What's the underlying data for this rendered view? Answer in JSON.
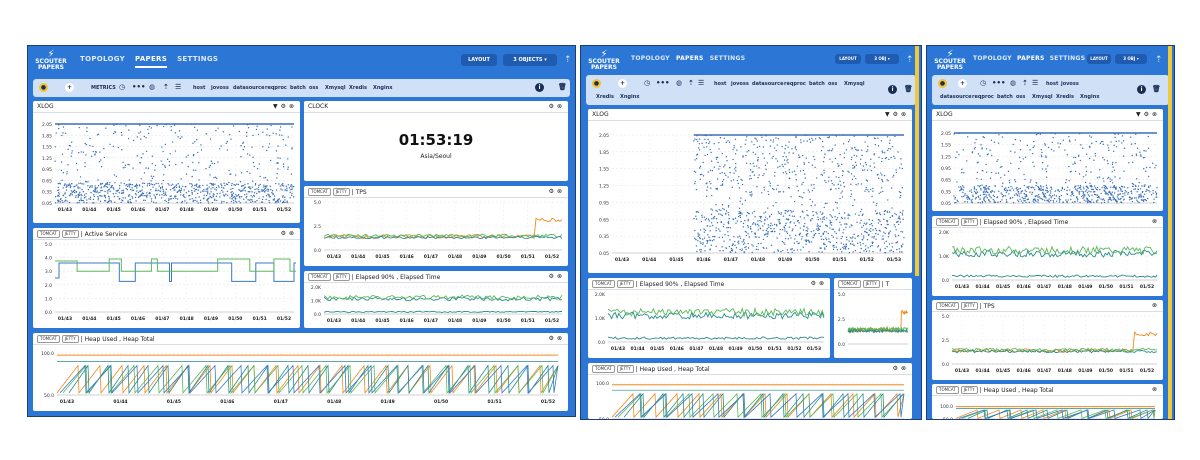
{
  "app": {
    "logo_line1": "SCOUTER",
    "logo_line2": "PAPERS",
    "nav": [
      "TOPOLOGY",
      "PAPERS",
      "SETTINGS"
    ],
    "layout_label": "LAYOUT",
    "objects_label_full": "3 OBJECTS",
    "objects_label_short": "3 OBJ"
  },
  "toolbar": {
    "metrics_label": "METRICS",
    "filters": [
      "host",
      "jovoss",
      "datasource",
      "reqproc",
      "batch",
      "oss",
      "Xmysql",
      "Xredis",
      "Xnginx"
    ]
  },
  "panels": {
    "xlog_title": "XLOG",
    "clock_title": "CLOCK",
    "clock_time": "01:53:19",
    "clock_timezone": "Asia/Seoul",
    "tag_a": "TOMCAT",
    "tag_b": "JETTY",
    "tps_title": "| TPS",
    "active_title": "| Active Service",
    "elapsed_title": "| Elapsed 90% , Elapsed Time",
    "heap_title": "| Heap Used , Heap Total",
    "tps_title_short": "| T"
  },
  "axes": {
    "xlog_y": [
      "2.05",
      "1.85",
      "1.55",
      "1.25",
      "0.95",
      "0.65",
      "0.35",
      "0.05"
    ],
    "xlog_y_sparse": [
      "2.05",
      "1.55",
      "1.25",
      "0.95",
      "0.65",
      "0.35",
      "0.05"
    ],
    "time_ticks": [
      "01/43",
      "01/44",
      "01/45",
      "01/46",
      "01/47",
      "01/48",
      "01/49",
      "01/50",
      "01/51",
      "01/52",
      "01/53"
    ],
    "tps_y": [
      "5.0",
      "2.5",
      "0.0"
    ],
    "active_y": [
      "5.0",
      "4.0",
      "3.0",
      "2.0",
      "1.0",
      "0.0"
    ],
    "elapsed_y": [
      "2.0K",
      "1.0K",
      "0.0"
    ],
    "heap_y": [
      "100.0",
      "50.0"
    ]
  },
  "colors": {
    "frame": "#2c77d6",
    "toolbar": "#cfe0f7",
    "scatter": "#3a6fb8",
    "series_orange": "#f28a1c",
    "series_green": "#5cb85c",
    "series_teal": "#2b8c8c",
    "series_blue": "#3a78c8",
    "accent_yellow": "#f0c83a"
  },
  "icons": [
    "settings-icon",
    "close-icon",
    "filter-icon",
    "pin-icon",
    "dropdown-icon",
    "plus-icon",
    "info-icon",
    "trash-icon",
    "menu-icon",
    "globe-icon",
    "clock-icon",
    "more-icon"
  ]
}
